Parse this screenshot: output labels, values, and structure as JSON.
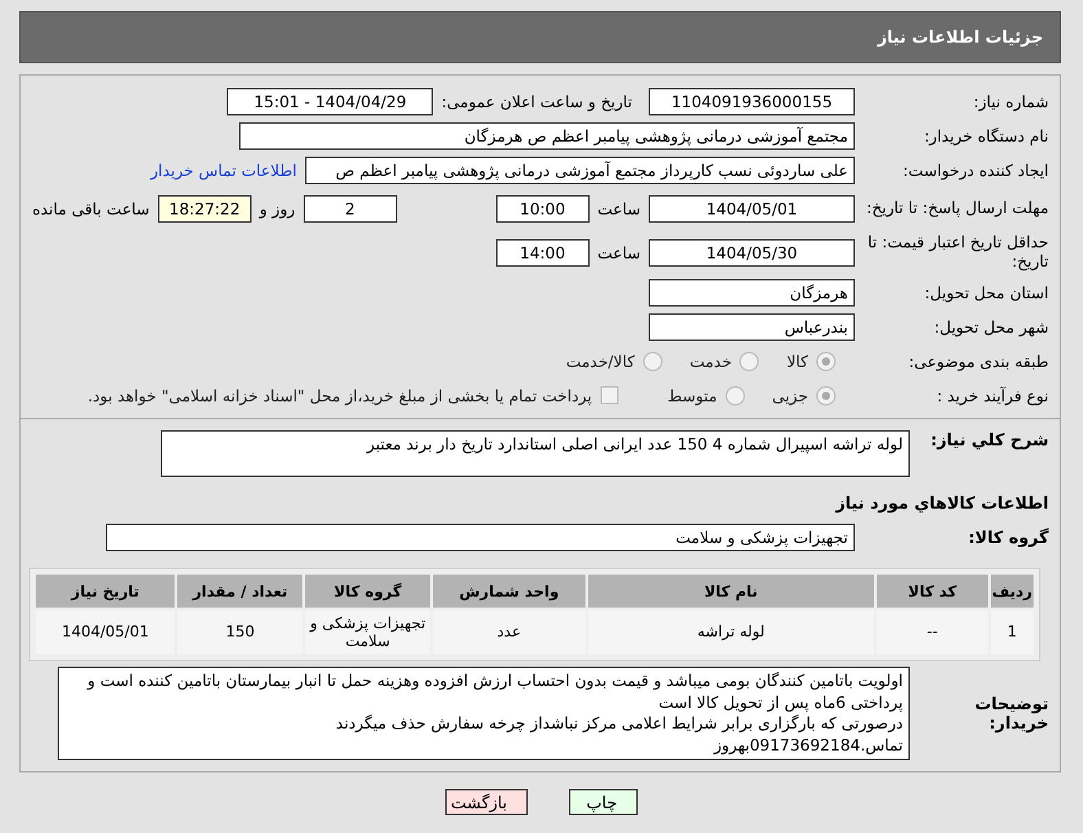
{
  "header": {
    "title": "جزئیات اطلاعات نیاز"
  },
  "need_number": {
    "label": "شماره نیاز:",
    "value": "1104091936000155"
  },
  "announce": {
    "label": "تاریخ و ساعت اعلان عمومی:",
    "value": "1404/04/29 - 15:01"
  },
  "buyer_org": {
    "label": "نام دستگاه خریدار:",
    "value": "مجتمع آموزشی درمانی پژوهشی پیامبر اعظم ص  هرمزگان"
  },
  "requester": {
    "label": "ایجاد کننده درخواست:",
    "value": "علی ساردوئی نسب کارپرداز مجتمع آموزشی درمانی پژوهشی پیامبر اعظم ص",
    "link": "اطلاعات تماس خریدار"
  },
  "reply_deadline": {
    "label": "مهلت ارسال پاسخ: تا تاریخ:",
    "date": "1404/05/01",
    "time_label": "ساعت",
    "time": "10:00",
    "days": "2",
    "days_label": "روز و",
    "remaining": "18:27:22",
    "remaining_label": "ساعت باقی مانده"
  },
  "price_validity": {
    "label": "حداقل تاریخ اعتبار قیمت: تا تاریخ:",
    "date": "1404/05/30",
    "time_label": "ساعت",
    "time": "14:00"
  },
  "province": {
    "label": "استان محل تحویل:",
    "value": "هرمزگان"
  },
  "city": {
    "label": "شهر محل تحویل:",
    "value": "بندرعباس"
  },
  "category": {
    "label": "طبقه بندی موضوعی:",
    "options": [
      {
        "label": "کالا",
        "selected": true
      },
      {
        "label": "خدمت",
        "selected": false
      },
      {
        "label": "کالا/خدمت",
        "selected": false
      }
    ]
  },
  "process": {
    "label": "نوع فرآیند خرید :",
    "options": [
      {
        "label": "جزیی",
        "selected": true
      },
      {
        "label": "متوسط",
        "selected": false
      }
    ],
    "treasury": {
      "label": "پرداخت تمام یا بخشی از مبلغ خرید،از محل \"اسناد خزانه اسلامی\" خواهد بود.",
      "checked": false
    }
  },
  "description": {
    "label": "شرح کلي نياز:",
    "value": "لوله تراشه اسپیرال شماره 4 150 عدد ایرانی اصلی استاندارد تاریخ دار برند معتبر"
  },
  "goods_heading": "اطلاعات کالاهاي مورد نياز",
  "goods_group": {
    "label": "گروه کالا:",
    "value": "تجهیزات پزشکی و سلامت"
  },
  "table": {
    "columns": [
      "ردیف",
      "کد کالا",
      "نام کالا",
      "واحد شمارش",
      "گروه کالا",
      "تعداد / مقدار",
      "تاریخ نیاز"
    ],
    "rows": [
      [
        "1",
        "--",
        "لوله تراشه",
        "عدد",
        "تجهیزات پزشکی و سلامت",
        "150",
        "1404/05/01"
      ]
    ]
  },
  "buyer_notes": {
    "label": "توضیحات خریدار:",
    "lines": [
      "اولویت باتامین کنندگان بومی میباشد و قیمت بدون احتساب ارزش افزوده وهزینه حمل تا انبار بیمارستان باتامین کننده است و پرداختی 6ماه پس از تحویل کالا است",
      "درصورتی که بارگزاری برابر شرایط اعلامی مرکز نباشداز چرخه سفارش حذف میگردند",
      "تماس.09173692184بهروز"
    ]
  },
  "buttons": [
    {
      "label": "چاپ",
      "kind": "print"
    },
    {
      "label": "بازگشت",
      "kind": "back"
    }
  ]
}
